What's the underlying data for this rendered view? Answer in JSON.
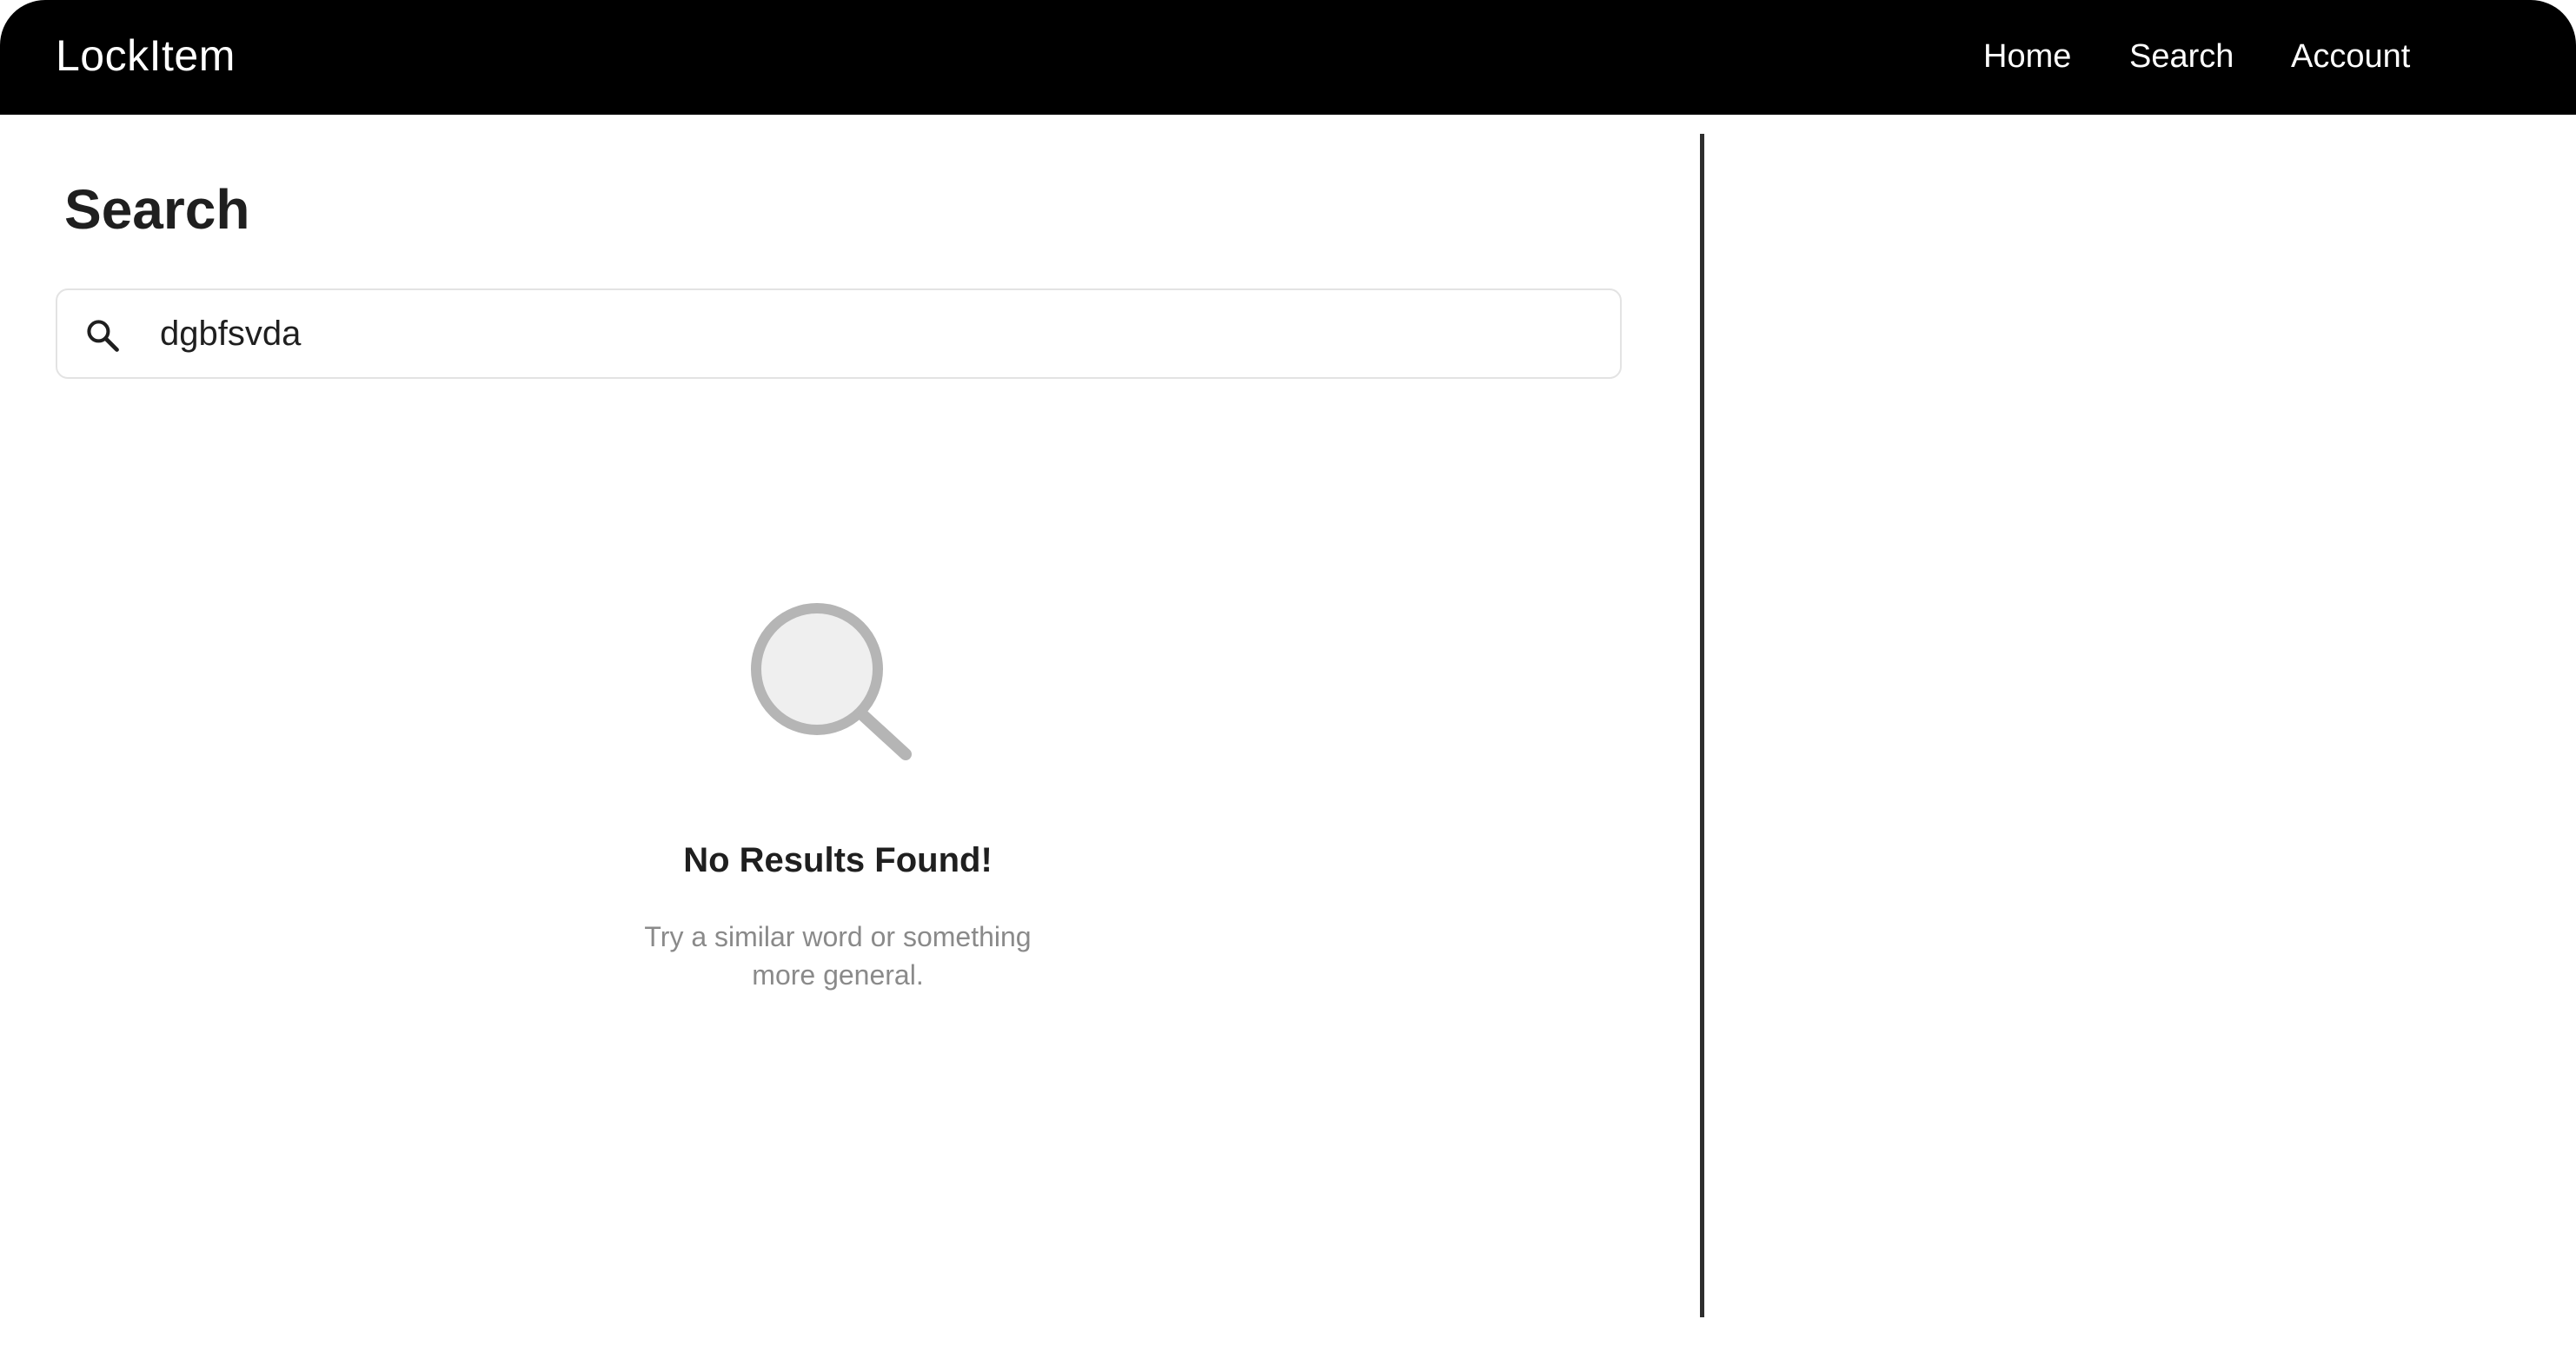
{
  "header": {
    "brand": "LockItem",
    "nav": {
      "home": "Home",
      "search": "Search",
      "account": "Account"
    }
  },
  "search": {
    "title": "Search",
    "value": "dgbfsvda",
    "icon": "search-icon"
  },
  "empty_state": {
    "icon": "magnifier-icon",
    "title": "No Results Found!",
    "message": "Try a similar word or something more general."
  },
  "colors": {
    "header_bg": "#000000",
    "header_text": "#ffffff",
    "divider": "#2e2e2e",
    "muted_text": "#8a8a8a",
    "empty_icon": "#b5b5b5"
  }
}
